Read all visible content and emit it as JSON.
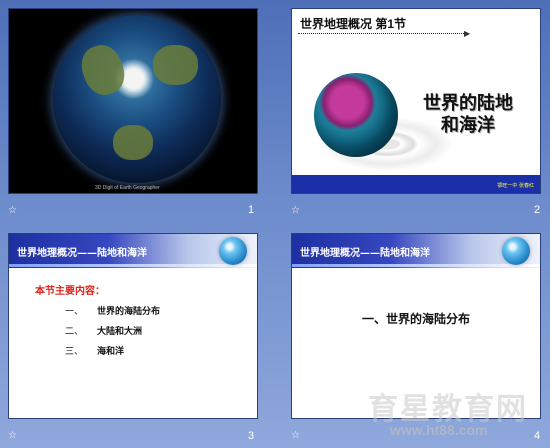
{
  "slides": [
    {
      "number": "1",
      "caption": "3D Digit of Earth Geographer"
    },
    {
      "number": "2",
      "header": "世界地理概况 第1节",
      "title_line1": "世界的陆地",
      "title_line2": "和海洋",
      "author": "鄂旺一中 张春红"
    },
    {
      "number": "3",
      "header": "世界地理概况——陆地和海洋",
      "section": "本节主要内容：",
      "items": [
        {
          "num": "一、",
          "text": "世界的海陆分布"
        },
        {
          "num": "二、",
          "text": "大陆和大洲"
        },
        {
          "num": "三、",
          "text": "海和洋"
        }
      ]
    },
    {
      "number": "4",
      "header": "世界地理概况——陆地和海洋",
      "center_text": "一、世界的海陆分布"
    }
  ],
  "star_glyph": "☆",
  "watermark": {
    "line1": "育星教育网",
    "line2": "www.ht88.com"
  }
}
